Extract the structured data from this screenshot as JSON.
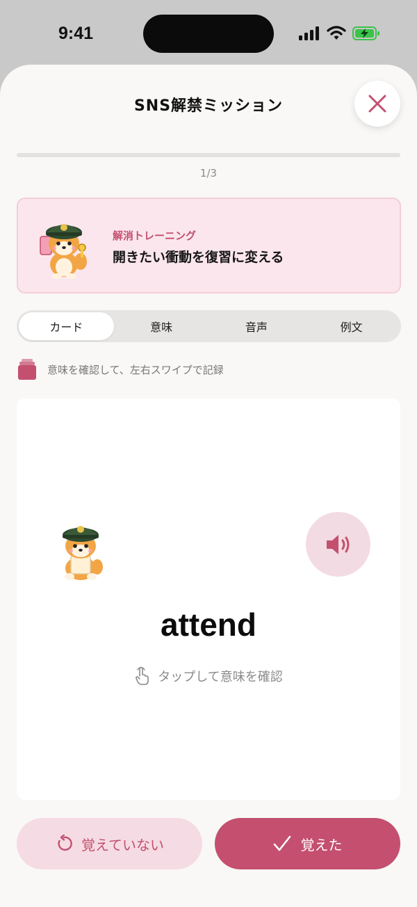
{
  "status_bar": {
    "time": "9:41",
    "icons": [
      "signal-icon",
      "wifi-icon",
      "battery-charging-icon"
    ],
    "battery_color": "#3bc34a"
  },
  "header": {
    "title": "SNS解禁ミッション",
    "close_icon": "close-icon",
    "close_color": "#c3506f"
  },
  "progress": {
    "current": 1,
    "total": 3,
    "label": "1/3"
  },
  "banner": {
    "mascot": "shiba-dog-mascot-with-phone",
    "subtitle": "解消トレーニング",
    "title": "開きたい衝動を復習に変える"
  },
  "tabs": [
    {
      "label": "カード",
      "active": true
    },
    {
      "label": "意味",
      "active": false
    },
    {
      "label": "音声",
      "active": false
    },
    {
      "label": "例文",
      "active": false
    }
  ],
  "hint": {
    "icon": "card-stack-icon",
    "text": "意味を確認して、左右スワイプで記録"
  },
  "card": {
    "mascot": "shiba-dog-mascot-reading",
    "speaker_icon": "speaker-icon",
    "word": "attend",
    "tap_icon": "tap-hand-icon",
    "tap_text": "タップして意味を確認"
  },
  "actions": {
    "not_remembered": "覚えていない",
    "not_remembered_icon": "undo-icon",
    "remembered": "覚えた",
    "remembered_icon": "check-icon"
  },
  "colors": {
    "accent": "#c44f6f",
    "accent_light": "#f5dbe3",
    "banner_bg": "#fbe6ee",
    "sheet_bg": "#f9f8f6"
  }
}
